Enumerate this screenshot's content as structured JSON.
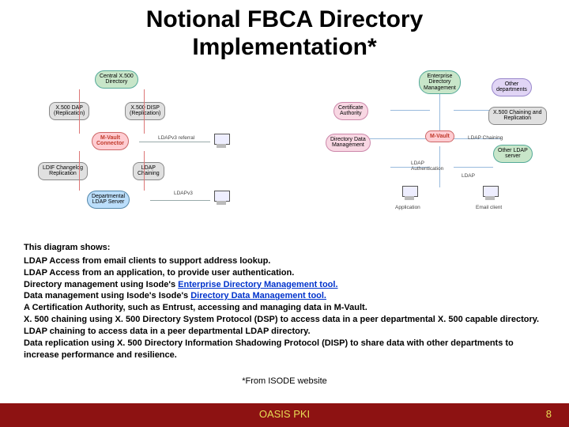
{
  "title_line1": "Notional FBCA Directory",
  "title_line2": "Implementation*",
  "diagram_left": {
    "central_x500": "Central X.500\\nDirectory",
    "x500_dap": "X.500 DAP\\n(Replication)",
    "x500_disp": "X.500 DISP\\n(Replication)",
    "mvault": "M-Vault\\nConnector",
    "ldif_changelog": "LDIF Changelog\\nReplication",
    "ldap_chaining": "LDAP\\nChaining",
    "departmental": "Departmental\\nLDAP Server",
    "edge_ldap_referral": "LDAPv3 referral",
    "edge_ldap3": "LDAPv3"
  },
  "diagram_right": {
    "cert_authority": "Certificate\\nAuthority",
    "dir_data_mgmt": "Directory Data\\nManagement",
    "ent_dir_mgmt": "Enterprise\\nDirectory\\nManagement",
    "mvault": "M-Vault",
    "other_depts": "Other\\ndepartments",
    "x500_chain": "X.500 Chaining and\\nReplication",
    "other_ldap": "Other LDAP\\nserver",
    "edge_ldap_chaining": "LDAP Chaining",
    "edge_ldap_auth": "LDAP\\nAuthentication",
    "edge_ldap": "LDAP",
    "terminal_application": "Application",
    "terminal_email": "Email client"
  },
  "body": {
    "lead": "This diagram shows:",
    "items": [
      "LDAP Access from email clients to support address lookup.",
      "LDAP Access from an application, to provide user authentication.",
      "Directory management using Isode's ",
      "Data management using Isode's Isode's ",
      "A Certification Authority, such as Entrust, accessing and managing data in M-Vault.",
      "X. 500 chaining using X. 500 Directory System Protocol (DSP) to access data in a peer departmental X. 500 capable directory.",
      "LDAP chaining to access data in a peer departmental LDAP directory.",
      "Data replication using X. 500 Directory Information Shadowing Protocol (DISP) to share data with other departments to increase performance and resilience."
    ],
    "link_edm": "Enterprise Directory Management tool.",
    "link_ddm": "Directory Data Management tool."
  },
  "attr": "*From ISODE website",
  "footer": {
    "label": "OASIS PKI",
    "page": "8"
  }
}
